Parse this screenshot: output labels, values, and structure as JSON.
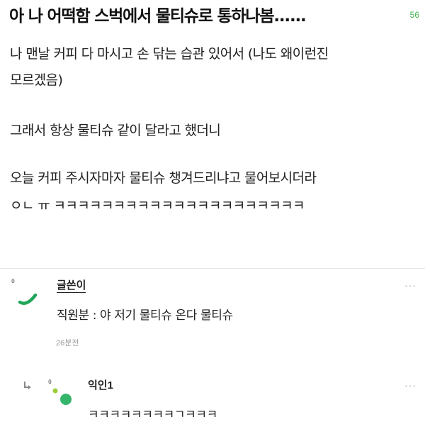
{
  "post": {
    "title": "아 나 어떡함 스벅에서 물티슈로 통하나봄......",
    "comment_count": "56",
    "lines": [
      "나 맨날 커피 다 마시고 손 닦는 습관 있어서 (나도 왜이런진",
      "모르겠음)",
      "그래서 항상 물티슈 같이 달라고 했더니",
      "오늘 커피 주시자마자 물티슈 챙겨드리냐고 물어보시더라",
      "ㅇㄴ ㅠ ㅋㅋㅋㅋㅋㅋㅋㅋㅋㅋㅋㅋㅋㅋㅋㅋㅋㅋㅋㅋㅋ"
    ]
  },
  "comments": [
    {
      "author": "글쓴이",
      "text": "직원분 : 야 저기 물티슈 온다 물티슈",
      "time": "26분전",
      "more": "···",
      "mark": "0",
      "avatar_color": "#21a65a"
    },
    {
      "author": "익인1",
      "text": "ㅋㅋㅋㅋㅋㅋㅋㅋㄱㅋㅋㅋ",
      "more": "···",
      "mark": "0",
      "reply_icon": "reply-arrow-icon",
      "avatar_color": "#35b56b",
      "avatar_dot_color": "#9ccc3a"
    }
  ]
}
